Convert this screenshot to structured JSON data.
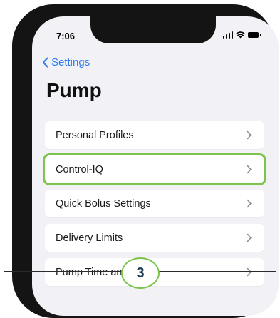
{
  "status_bar": {
    "time": "7:06"
  },
  "nav": {
    "back_label": "Settings"
  },
  "page": {
    "title": "Pump"
  },
  "menu": {
    "items": [
      {
        "label": "Personal Profiles",
        "highlighted": false
      },
      {
        "label": "Control-IQ",
        "highlighted": true
      },
      {
        "label": "Quick Bolus Settings",
        "highlighted": false
      },
      {
        "label": "Delivery Limits",
        "highlighted": false
      },
      {
        "label": "Pump Time and",
        "highlighted": false
      }
    ]
  },
  "callout": {
    "step": "3"
  },
  "colors": {
    "accent_blue": "#2f7cf6",
    "highlight_green": "#7dc44e",
    "badge_text": "#1f3a4d"
  }
}
